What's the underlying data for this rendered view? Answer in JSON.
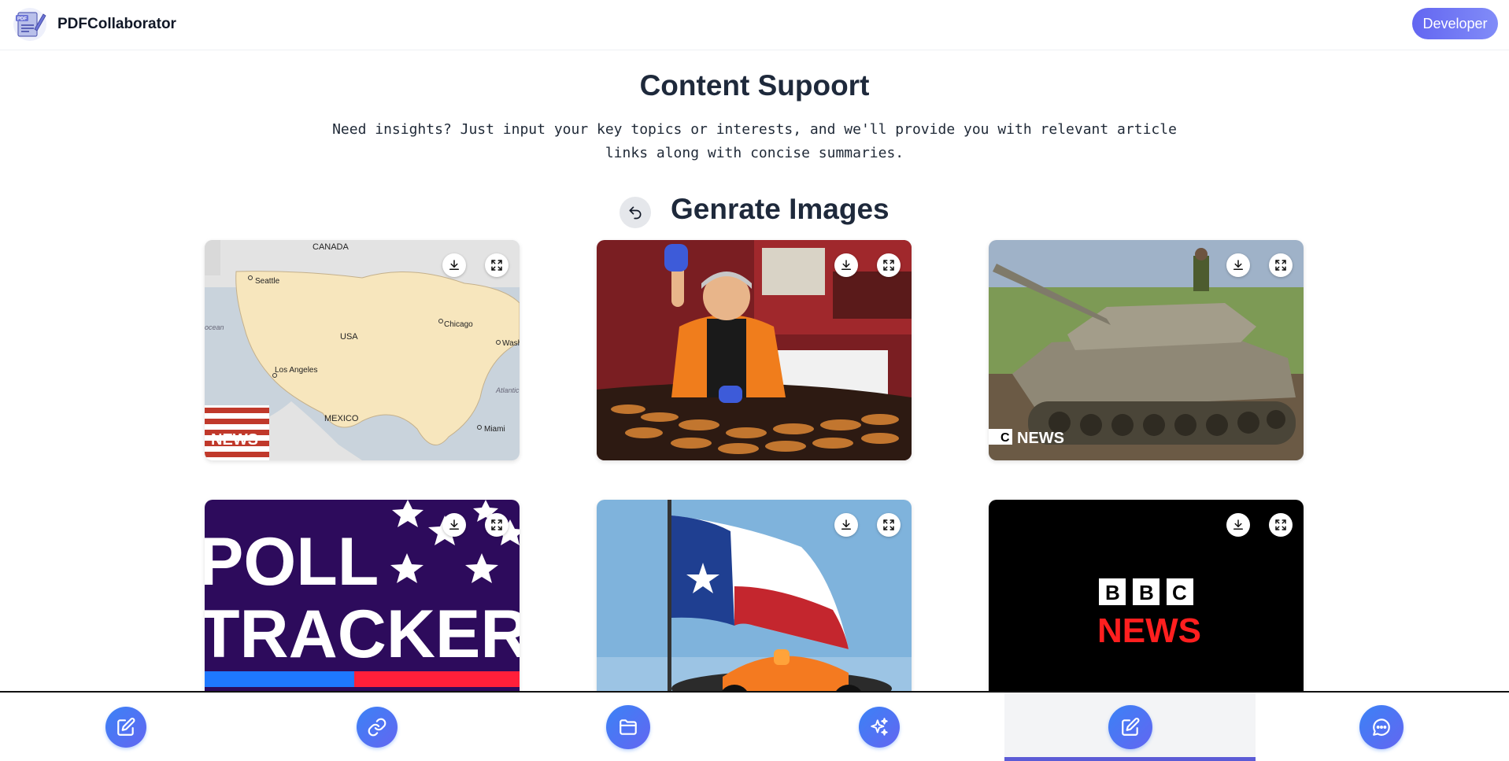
{
  "header": {
    "brand": "PDFCollaborator",
    "logo_icon": "pdf-document-logo-icon",
    "developer_button": "Developer"
  },
  "content": {
    "title": "Content Supoort",
    "subtitle": "Need insights? Just input your key topics or interests, and we'll provide you with relevant article links along with concise summaries.",
    "section_title": "Genrate Images"
  },
  "cards": [
    {
      "subject": "map-usa",
      "text": [
        "CANADA",
        "Seattle",
        "Chicago",
        "USA",
        "Los Angeles",
        "MEXICO",
        "Miami",
        "Wash",
        "Atlantic",
        "ocean",
        "NEWS"
      ]
    },
    {
      "subject": "food-vendor",
      "text": []
    },
    {
      "subject": "tank",
      "text": [
        "C",
        "NEWS"
      ]
    },
    {
      "subject": "poll-tracker",
      "text": [
        "POLL",
        "TRACKER"
      ]
    },
    {
      "subject": "texas-flag-race-car",
      "text": []
    },
    {
      "subject": "bbc-news-logo",
      "text": [
        "B",
        "B",
        "C",
        "NEWS"
      ]
    }
  ],
  "bottom_nav": [
    {
      "icon": "edit-icon",
      "active": false
    },
    {
      "icon": "link-icon",
      "active": false
    },
    {
      "icon": "folder-icon",
      "active": false
    },
    {
      "icon": "sparkles-icon",
      "active": false
    },
    {
      "icon": "edit-icon",
      "active": true
    },
    {
      "icon": "chat-icon",
      "active": false
    }
  ],
  "colors": {
    "accent": "#6366f1",
    "nav_gradient_start": "#3b82f6",
    "nav_gradient_end": "#6366f1",
    "active_indicator": "#5b5bd6"
  }
}
